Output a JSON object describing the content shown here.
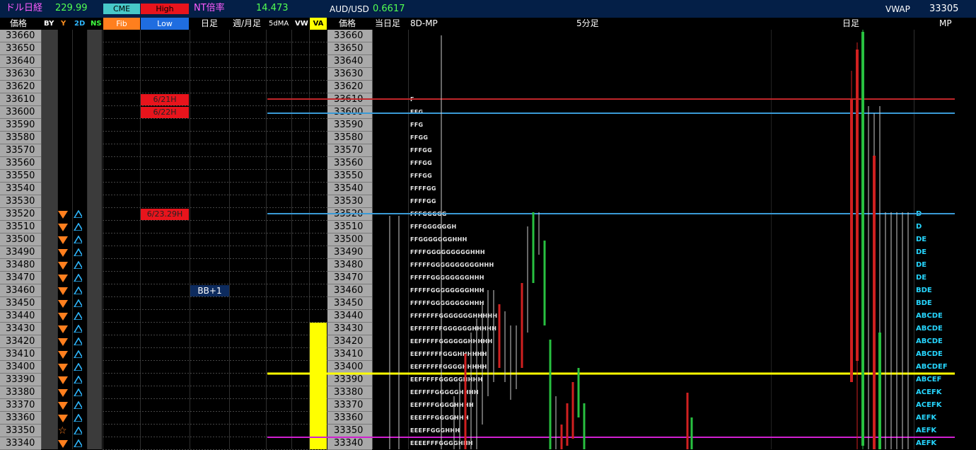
{
  "top": {
    "label_yen": "ドル日経",
    "val_yen": "229.99",
    "btn_cme": "CME",
    "btn_high": "High",
    "btn_fib": "Fib",
    "btn_low": "Low",
    "label_nt": "NT倍率",
    "val_nt": "14.473",
    "label_aud": "AUD/USD",
    "val_aud": "0.6617",
    "label_vwap": "VWAP",
    "val_vwap": "33305"
  },
  "header": {
    "price": "価格",
    "by": "BY",
    "y": "Y",
    "d2": "2D",
    "ns": "NS",
    "day": "日足",
    "weekmonth": "週/月足",
    "ma5": "5dMA",
    "vw": "VW",
    "va": "VA",
    "price2": "価格",
    "today": "当日足",
    "mp8d": "8D-MP",
    "min5": "5分足",
    "day2": "日足",
    "mp": "MP"
  },
  "prices": [
    "33660",
    "33650",
    "33640",
    "33630",
    "33620",
    "33610",
    "33600",
    "33590",
    "33580",
    "33570",
    "33560",
    "33550",
    "33540",
    "33530",
    "33520",
    "33510",
    "33500",
    "33490",
    "33480",
    "33470",
    "33460",
    "33450",
    "33440",
    "33430",
    "33420",
    "33410",
    "33400",
    "33390",
    "33380",
    "33370",
    "33360",
    "33350",
    "33340"
  ],
  "tags": {
    "h621": "6/21H",
    "h622": "6/22H",
    "h623": "6/23.29H",
    "bb": "BB+1"
  },
  "tpo": {
    "33610": "F",
    "33600": "FFG",
    "33590": "FFG",
    "33580": "FFGG",
    "33570": "FFFGG",
    "33560": "FFFGG",
    "33550": "FFFGG",
    "33540": "FFFFGG",
    "33530": "FFFFGG",
    "33520": "FFFGGGGG",
    "33510": "FFFGGGGGGH",
    "33500": "FFGGGGGGGHHH",
    "33490": "FFFFGGGGGGGGGHHH",
    "33480": "FFFFFGGGGGGGGGGHHH",
    "33470": "FFFFFGGGGGGGGHHH",
    "33460": "FFFFFGGGGGGGGHHH",
    "33450": "FFFFFGGGGGGGGHHH",
    "33440": "FFFFFFFGGGGGGGHHHHH",
    "33430": "EFFFFFFFGGGGGGHHHHH",
    "33420": "EEFFFFFGGGGGGHHHHH",
    "33410": "EEFFFFFFGGGHHHHHH",
    "33400": "EEFFFFFFGGGGHHHHH",
    "33390": "EEFFFFFGGGGGHHHH",
    "33380": "EEFFFFGGGGGHHHH",
    "33370": "EEFFFFGGGGHHHH",
    "33360": "EEEFFFGGGGHHH",
    "33350": "EEEFFGGGHHH",
    "33340": "EEEEFFFGGGGHHH"
  },
  "mp_letters": {
    "33520": "D",
    "33510": "D",
    "33500": "DE",
    "33490": "DE",
    "33480": "DE",
    "33470": "DE",
    "33460": "BDE",
    "33450": "BDE",
    "33440": "ABCDE",
    "33430": "ABCDE",
    "33420": "ABCDE",
    "33410": "ABCDE",
    "33400": "ABCDEF",
    "33390": "ABCEF",
    "33380": "ACEFK",
    "33370": "ACEFK",
    "33360": "AEFK",
    "33350": "AEFK",
    "33340": "AEFK"
  },
  "colors": {
    "line_red": "#c0262a",
    "line_blue": "#3a9ad6",
    "line_yellow": "#ffff00",
    "line_magenta": "#d020d0",
    "candle_up": "#28c040",
    "candle_down": "#d02020",
    "va_bar": "#ffff00"
  }
}
